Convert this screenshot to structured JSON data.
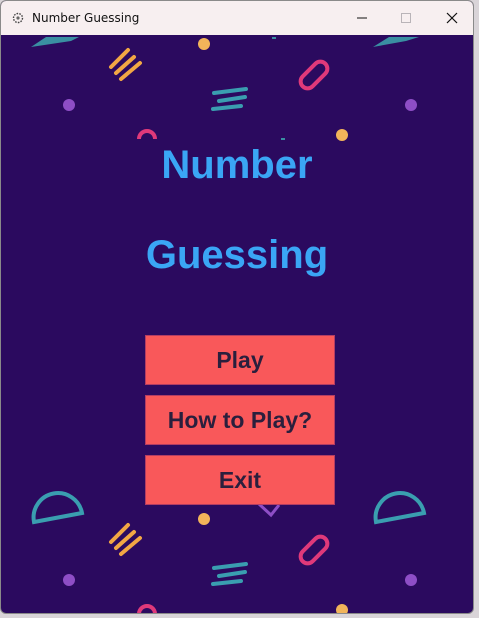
{
  "window": {
    "title": "Number Guessing",
    "app_icon": "gear-icon",
    "controls": [
      "minimize-icon",
      "maximize-icon",
      "close-icon"
    ]
  },
  "game": {
    "title_line1": "Number",
    "title_line2": "Guessing",
    "buttons": {
      "play": "Play",
      "how_to_play": "How to Play?",
      "exit": "Exit"
    }
  },
  "colors": {
    "background": "#2b0a5f",
    "heading": "#3aa6f5",
    "button_fill": "#f9585a",
    "button_text": "#2a1f3d"
  }
}
